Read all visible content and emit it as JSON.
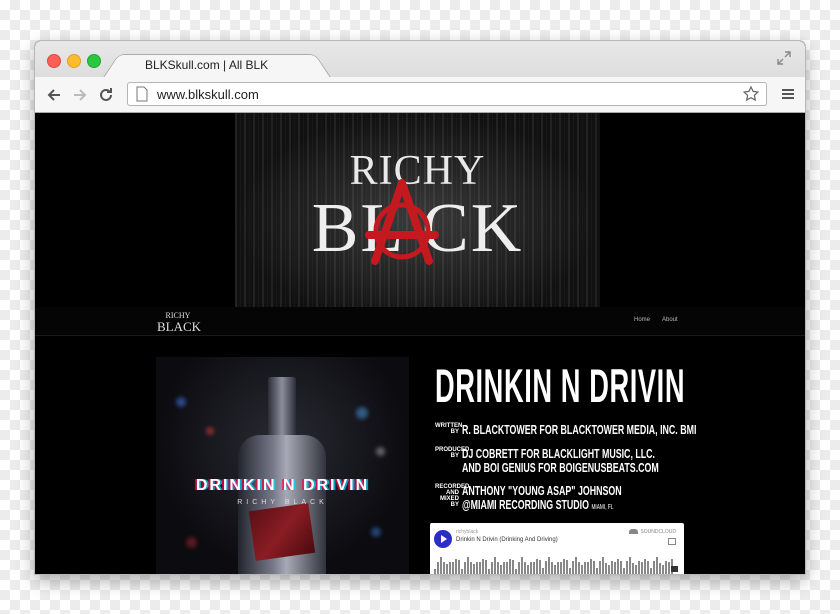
{
  "browser": {
    "tab_title": "BLKSkull.com | All BLK",
    "url": "www.blkskull.com"
  },
  "hero": {
    "line1": "RICHY",
    "line2": "BL CK",
    "accent_color": "#c41a1f"
  },
  "nav": {
    "logo_line1": "RICHY",
    "logo_line2": "BLACK",
    "links": [
      "Home",
      "About"
    ]
  },
  "album": {
    "title": "DRINKIN N DRIVIN",
    "artist": "RICHY BLACK"
  },
  "credits": {
    "song_title": "DRINKIN N DRIVIN",
    "written_by_label": "WRITTEN BY",
    "written_by": "R. BLACKTOWER FOR BLACKTOWER MEDIA, INC. BMI",
    "produced_by_label": "PRODUCED BY",
    "produced_by_line1": "DJ COBRETT FOR BLACKLIGHT MUSIC, LLC.",
    "produced_by_line2": "AND BOI GENIUS FOR BOIGENUSBEATS.COM",
    "recorded_label": "RECORDED AND MIXED BY",
    "recorded_by": "ANTHONY \"YOUNG ASAP\" JOHNSON",
    "studio": "@MIAMI RECORDING STUDIO",
    "studio_location": "MIAMI, FL"
  },
  "soundcloud": {
    "user": "richyblack",
    "track": "Drinkin N Drivin (Drinking And Driving)",
    "brand": "SOUNDCLOUD"
  }
}
